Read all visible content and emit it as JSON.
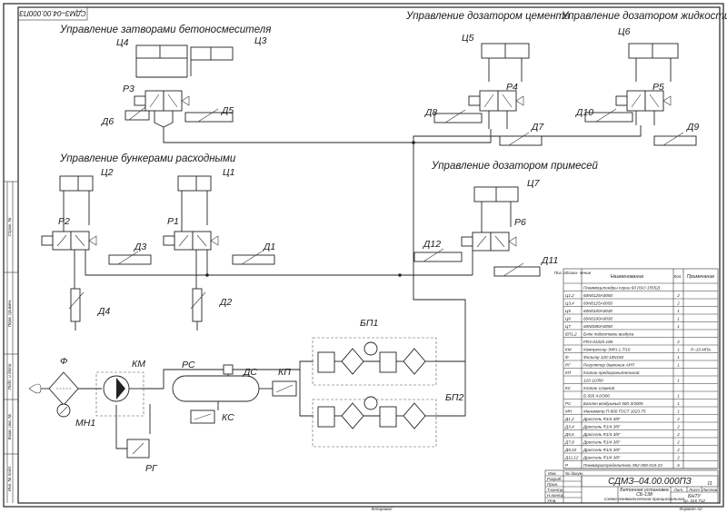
{
  "stamp_corner": "СДМЗ–04.00.000ПЗ",
  "sections": {
    "mixer_gates": "Управление затворами бетоносмесителя",
    "cement_doser": "Управление дозатором цемента",
    "liquid_doser": "Управление дозатором жидкости",
    "hoppers": "Управление бункерами расходными",
    "additive_doser": "Управление дозатором примесей"
  },
  "labels": {
    "c1": "Ц1",
    "c2": "Ц2",
    "c3": "Ц3",
    "c4": "Ц4",
    "c5": "Ц5",
    "c6": "Ц6",
    "c7": "Ц7",
    "p1": "Р1",
    "p2": "Р2",
    "p3": "Р3",
    "p4": "Р4",
    "p5": "Р5",
    "p6": "Р6",
    "d1": "Д1",
    "d2": "Д2",
    "d3": "Д3",
    "d4": "Д4",
    "d5": "Д5",
    "d6": "Д6",
    "d7": "Д7",
    "d8": "Д8",
    "d9": "Д9",
    "d10": "Д10",
    "d11": "Д11",
    "d12": "Д12",
    "bp1": "БП1",
    "bp2": "БП2",
    "f": "Ф",
    "km": "КМ",
    "mn1": "МН1",
    "rs": "РС",
    "ds": "ДС",
    "kp": "КП",
    "ks": "КС",
    "rg": "РГ"
  },
  "spec": {
    "headers": [
      "Поз. обозна- чение",
      "Наименование",
      "Кол.",
      "Примечание"
    ],
    "rows": [
      {
        "pos": "",
        "name": "Пневмоцилиндры серии 60 (ISO 15552)",
        "qty": "",
        "note": ""
      },
      {
        "pos": "Ц1,2",
        "name": "60N0125A0050",
        "qty": "2",
        "note": ""
      },
      {
        "pos": "Ц3,4",
        "name": "60N0125A0050",
        "qty": "2",
        "note": ""
      },
      {
        "pos": "Ц5",
        "name": "60N0100A0030",
        "qty": "1",
        "note": ""
      },
      {
        "pos": "Ц6",
        "name": "60N0100A0030",
        "qty": "1",
        "note": ""
      },
      {
        "pos": "Ц7",
        "name": "60N0080A0050",
        "qty": "1",
        "note": ""
      },
      {
        "pos": "БП1,2",
        "name": "Блок подготовки воздуха",
        "qty": "",
        "note": ""
      },
      {
        "pos": "",
        "name": "FR3-01025-185",
        "qty": "2",
        "note": ""
      },
      {
        "pos": "КМ",
        "name": "Компрессор ЭЖЧ 1.7/10",
        "qty": "1",
        "note": "Р–10 МПа"
      },
      {
        "pos": "Ф",
        "name": "Фильтр 120-10N150",
        "qty": "1",
        "note": ""
      },
      {
        "pos": "РГ",
        "name": "Регулятор давления АРП",
        "qty": "1",
        "note": ""
      },
      {
        "pos": "КП",
        "name": "Клапан предохранительный",
        "qty": "",
        "note": ""
      },
      {
        "pos": "",
        "name": "120-11050",
        "qty": "1",
        "note": ""
      },
      {
        "pos": "КС",
        "name": "Клапан сливной",
        "qty": "",
        "note": ""
      },
      {
        "pos": "",
        "name": "Б-565 4.0/300",
        "qty": "1",
        "note": ""
      },
      {
        "pos": "РС",
        "name": "Баллон воздушный 500-3/3005",
        "qty": "1",
        "note": ""
      },
      {
        "pos": "МН",
        "name": "Манометр П-800 ГОСТ 1023-75",
        "qty": "1",
        "note": ""
      },
      {
        "pos": "Д1,2",
        "name": "Дроссель R1/4 3/8\"",
        "qty": "2",
        "note": ""
      },
      {
        "pos": "Д3,4",
        "name": "Дроссель R1/4 3/8\"",
        "qty": "2",
        "note": ""
      },
      {
        "pos": "Д5,6",
        "name": "Дроссель R1/4 3/8\"",
        "qty": "2",
        "note": ""
      },
      {
        "pos": "Д7,8",
        "name": "Дроссель R1/4 3/8\"",
        "qty": "2",
        "note": ""
      },
      {
        "pos": "Д9,10",
        "name": "Дроссель R1/4 3/8\"",
        "qty": "2",
        "note": ""
      },
      {
        "pos": "Д11,12",
        "name": "Дроссель R1/4 3/8\"",
        "qty": "2",
        "note": ""
      },
      {
        "pos": "Р",
        "name": "Пневмораспределитель 952-000-015-23",
        "qty": "6",
        "note": ""
      }
    ]
  },
  "title_block": {
    "doc": "СДМЗ–04.00.000ПЗ",
    "title_line1": "Бетонная установка",
    "title_line2": "СБ-138",
    "title_line3": "Схема пневматическая принципиальная",
    "sheet_label": "Лист",
    "sheets_label": "Листов",
    "sheets_value": "11",
    "letter_label": "Лит.",
    "org_line1": "БНТУ",
    "org_line2": "гр. 316 712",
    "role_dev": "Разраб.",
    "role_check": "Пров.",
    "role_tcontrol": "Т.контр.",
    "role_ncontrol": "Н.контр.",
    "role_approve": "Утв.",
    "col_change": "Изм.",
    "col_sheet": "Лист",
    "col_doc": "№ докум.",
    "col_sign": "Подп.",
    "col_date": "Дата"
  },
  "footer": {
    "copied": "Копировал",
    "format": "Формат  A2"
  },
  "side_strip": {
    "inv_orig": "Инв. № подл.",
    "sign_date": "Подп. и дата",
    "inv_dup": "Взам. инв. №",
    "first_use": "Перв. примен.",
    "ref": "Справ. №"
  }
}
